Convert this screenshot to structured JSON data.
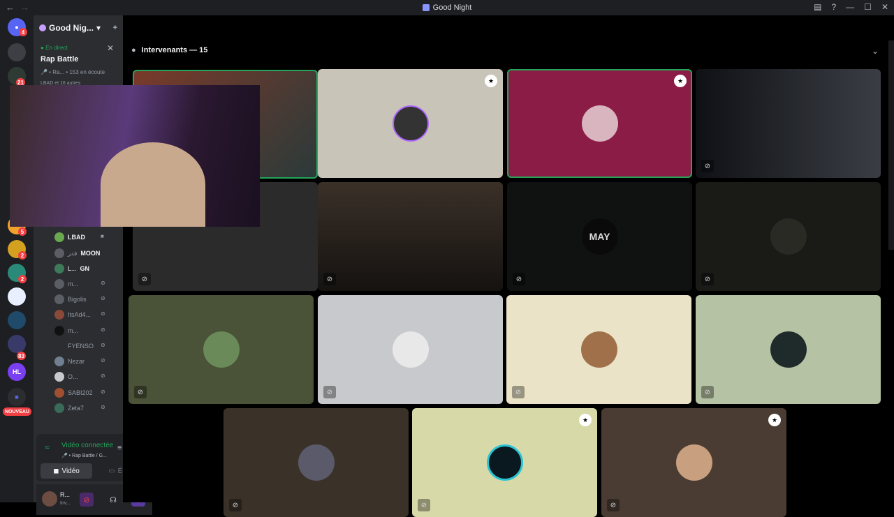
{
  "window": {
    "title": "Good Night",
    "controls": [
      "—",
      "☐",
      "✕"
    ]
  },
  "server": {
    "name": "Good Nig...",
    "chevron": "▾"
  },
  "guild_badges": [
    "4",
    "21",
    "5",
    "2",
    "2",
    "83"
  ],
  "guild_new_badge": "NOUVEAU",
  "live_event": {
    "status": "En direct",
    "title": "Rap Battle",
    "subtitle": "🎤 • Ra...",
    "listeners": "153 en écoute",
    "attendees": "LBAD et 16 autres"
  },
  "members": [
    {
      "name": "LBAD",
      "extra": ""
    },
    {
      "name": "فدر",
      "extra": "MOON"
    },
    {
      "name": "L...",
      "extra": "GN"
    },
    {
      "name": "m...",
      "extra": ""
    },
    {
      "name": "Bigolis",
      "extra": ""
    },
    {
      "name": "ItsAd4...",
      "extra": ""
    },
    {
      "name": "m...",
      "extra": ""
    },
    {
      "name": "FYENSO",
      "extra": ""
    },
    {
      "name": "Nezar",
      "extra": ""
    },
    {
      "name": "O...",
      "extra": ""
    },
    {
      "name": "SABI202",
      "extra": ""
    },
    {
      "name": "Zeta7",
      "extra": ""
    }
  ],
  "voice": {
    "status": "Vidéo connectée",
    "channel": "🎤 • Rap Battle / G...",
    "video_label": "Vidéo",
    "screen_label": "Écran"
  },
  "user": {
    "name": "R...",
    "status": "Inv..."
  },
  "stage": {
    "header": "Intervenants — 15"
  },
  "tiles": [
    {
      "name": "tile-1",
      "bg": "#3a2a2a",
      "speaking": true,
      "shield": false,
      "muted": false
    },
    {
      "name": "tile-2",
      "bg": "#c8c4b8",
      "speaking": false,
      "shield": true,
      "muted": false
    },
    {
      "name": "tile-3",
      "bg": "#8b1c46",
      "speaking": true,
      "shield": true,
      "muted": false
    },
    {
      "name": "tile-4",
      "bg": "#1b1d22",
      "speaking": false,
      "shield": false,
      "muted": true
    },
    {
      "name": "tile-5",
      "bg": "#2b2b2b",
      "speaking": false,
      "shield": false,
      "muted": true
    },
    {
      "name": "tile-6",
      "bg": "#3a3028",
      "speaking": false,
      "shield": false,
      "muted": true
    },
    {
      "name": "tile-7",
      "bg": "#0f1210",
      "speaking": false,
      "shield": false,
      "muted": true,
      "avatar_label": "MAY"
    },
    {
      "name": "tile-8",
      "bg": "#1a1a17",
      "speaking": false,
      "shield": false,
      "muted": true
    },
    {
      "name": "tile-9",
      "bg": "#4a5237",
      "speaking": false,
      "shield": false,
      "muted": true
    },
    {
      "name": "tile-10",
      "bg": "#c8c9cc",
      "speaking": false,
      "shield": false,
      "muted": true
    },
    {
      "name": "tile-11",
      "bg": "#eae3c7",
      "speaking": false,
      "shield": false,
      "muted": true
    },
    {
      "name": "tile-12",
      "bg": "#b5c2a3",
      "speaking": false,
      "shield": false,
      "muted": true
    },
    {
      "name": "tile-13",
      "bg": "#3a3228",
      "speaking": false,
      "shield": false,
      "muted": true
    },
    {
      "name": "tile-14",
      "bg": "#d8d9a8",
      "speaking": false,
      "shield": true,
      "muted": true
    },
    {
      "name": "tile-15",
      "bg": "#4a3c33",
      "speaking": false,
      "shield": true,
      "muted": true
    }
  ]
}
